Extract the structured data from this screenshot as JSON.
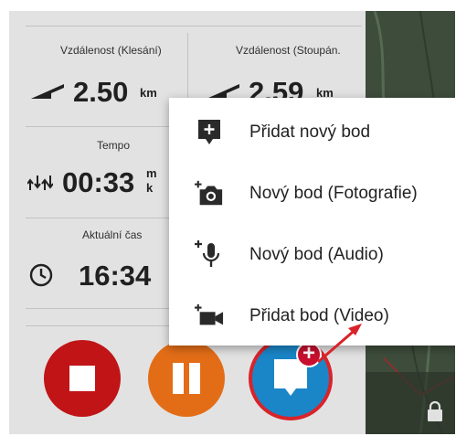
{
  "stats": {
    "distance_descent": {
      "label": "Vzdálenost (Klesání)",
      "value": "2.50",
      "unit": "km"
    },
    "distance_ascent": {
      "label": "Vzdálenost (Stoupán.",
      "value": "2.59",
      "unit": "km"
    },
    "pace": {
      "label": "Tempo",
      "value": "00:33",
      "unit_top": "m",
      "unit_bottom": "k"
    },
    "current_time": {
      "label": "Aktuální čas",
      "value": "16:34"
    }
  },
  "menu": {
    "items": [
      {
        "label": "Přidat nový bod",
        "icon": "add-point-icon"
      },
      {
        "label": "Nový bod (Fotografie)",
        "icon": "add-photo-icon"
      },
      {
        "label": "Nový bod (Audio)",
        "icon": "add-audio-icon"
      },
      {
        "label": "Přidat bod (Video)",
        "icon": "add-video-icon"
      }
    ]
  },
  "buttons": {
    "plus_badge": "+"
  },
  "colors": {
    "stop": "#c01417",
    "pause": "#e36d17",
    "waypoint": "#1a86c7",
    "highlight": "#d9232a"
  }
}
